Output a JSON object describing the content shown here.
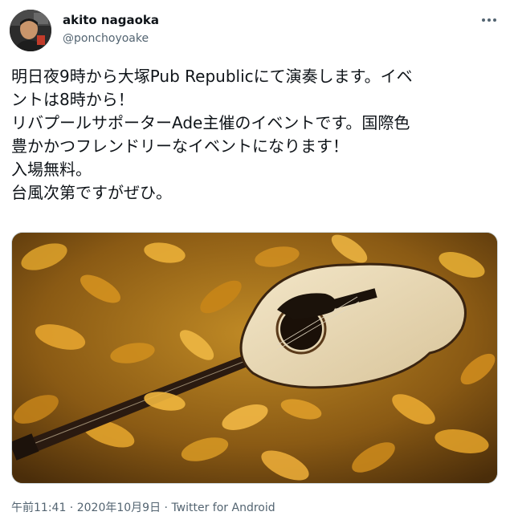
{
  "user": {
    "display_name": "akito nagaoka",
    "handle": "@ponchoyoake"
  },
  "tweet": {
    "lines": [
      "明日夜9時から大塚Pub Republicにて演奏します。イベ",
      "ントは8時から！",
      "リバプールサポーターAde主催のイベントです。国際色",
      "豊かかつフレンドリーなイベントになります！",
      "入場無料。",
      "台風次第ですがぜひ。"
    ],
    "media": {
      "description_icon": "guitar-photo"
    }
  },
  "meta": {
    "time": "午前11:41",
    "separator": " · ",
    "date": "2020年10月9日",
    "separator2": " · ",
    "source": "Twitter for Android"
  },
  "icons": {
    "more": "more-horizontal-icon"
  },
  "colors": {
    "text": "#0f1419",
    "secondary": "#536471",
    "border": "#cfd9de"
  }
}
